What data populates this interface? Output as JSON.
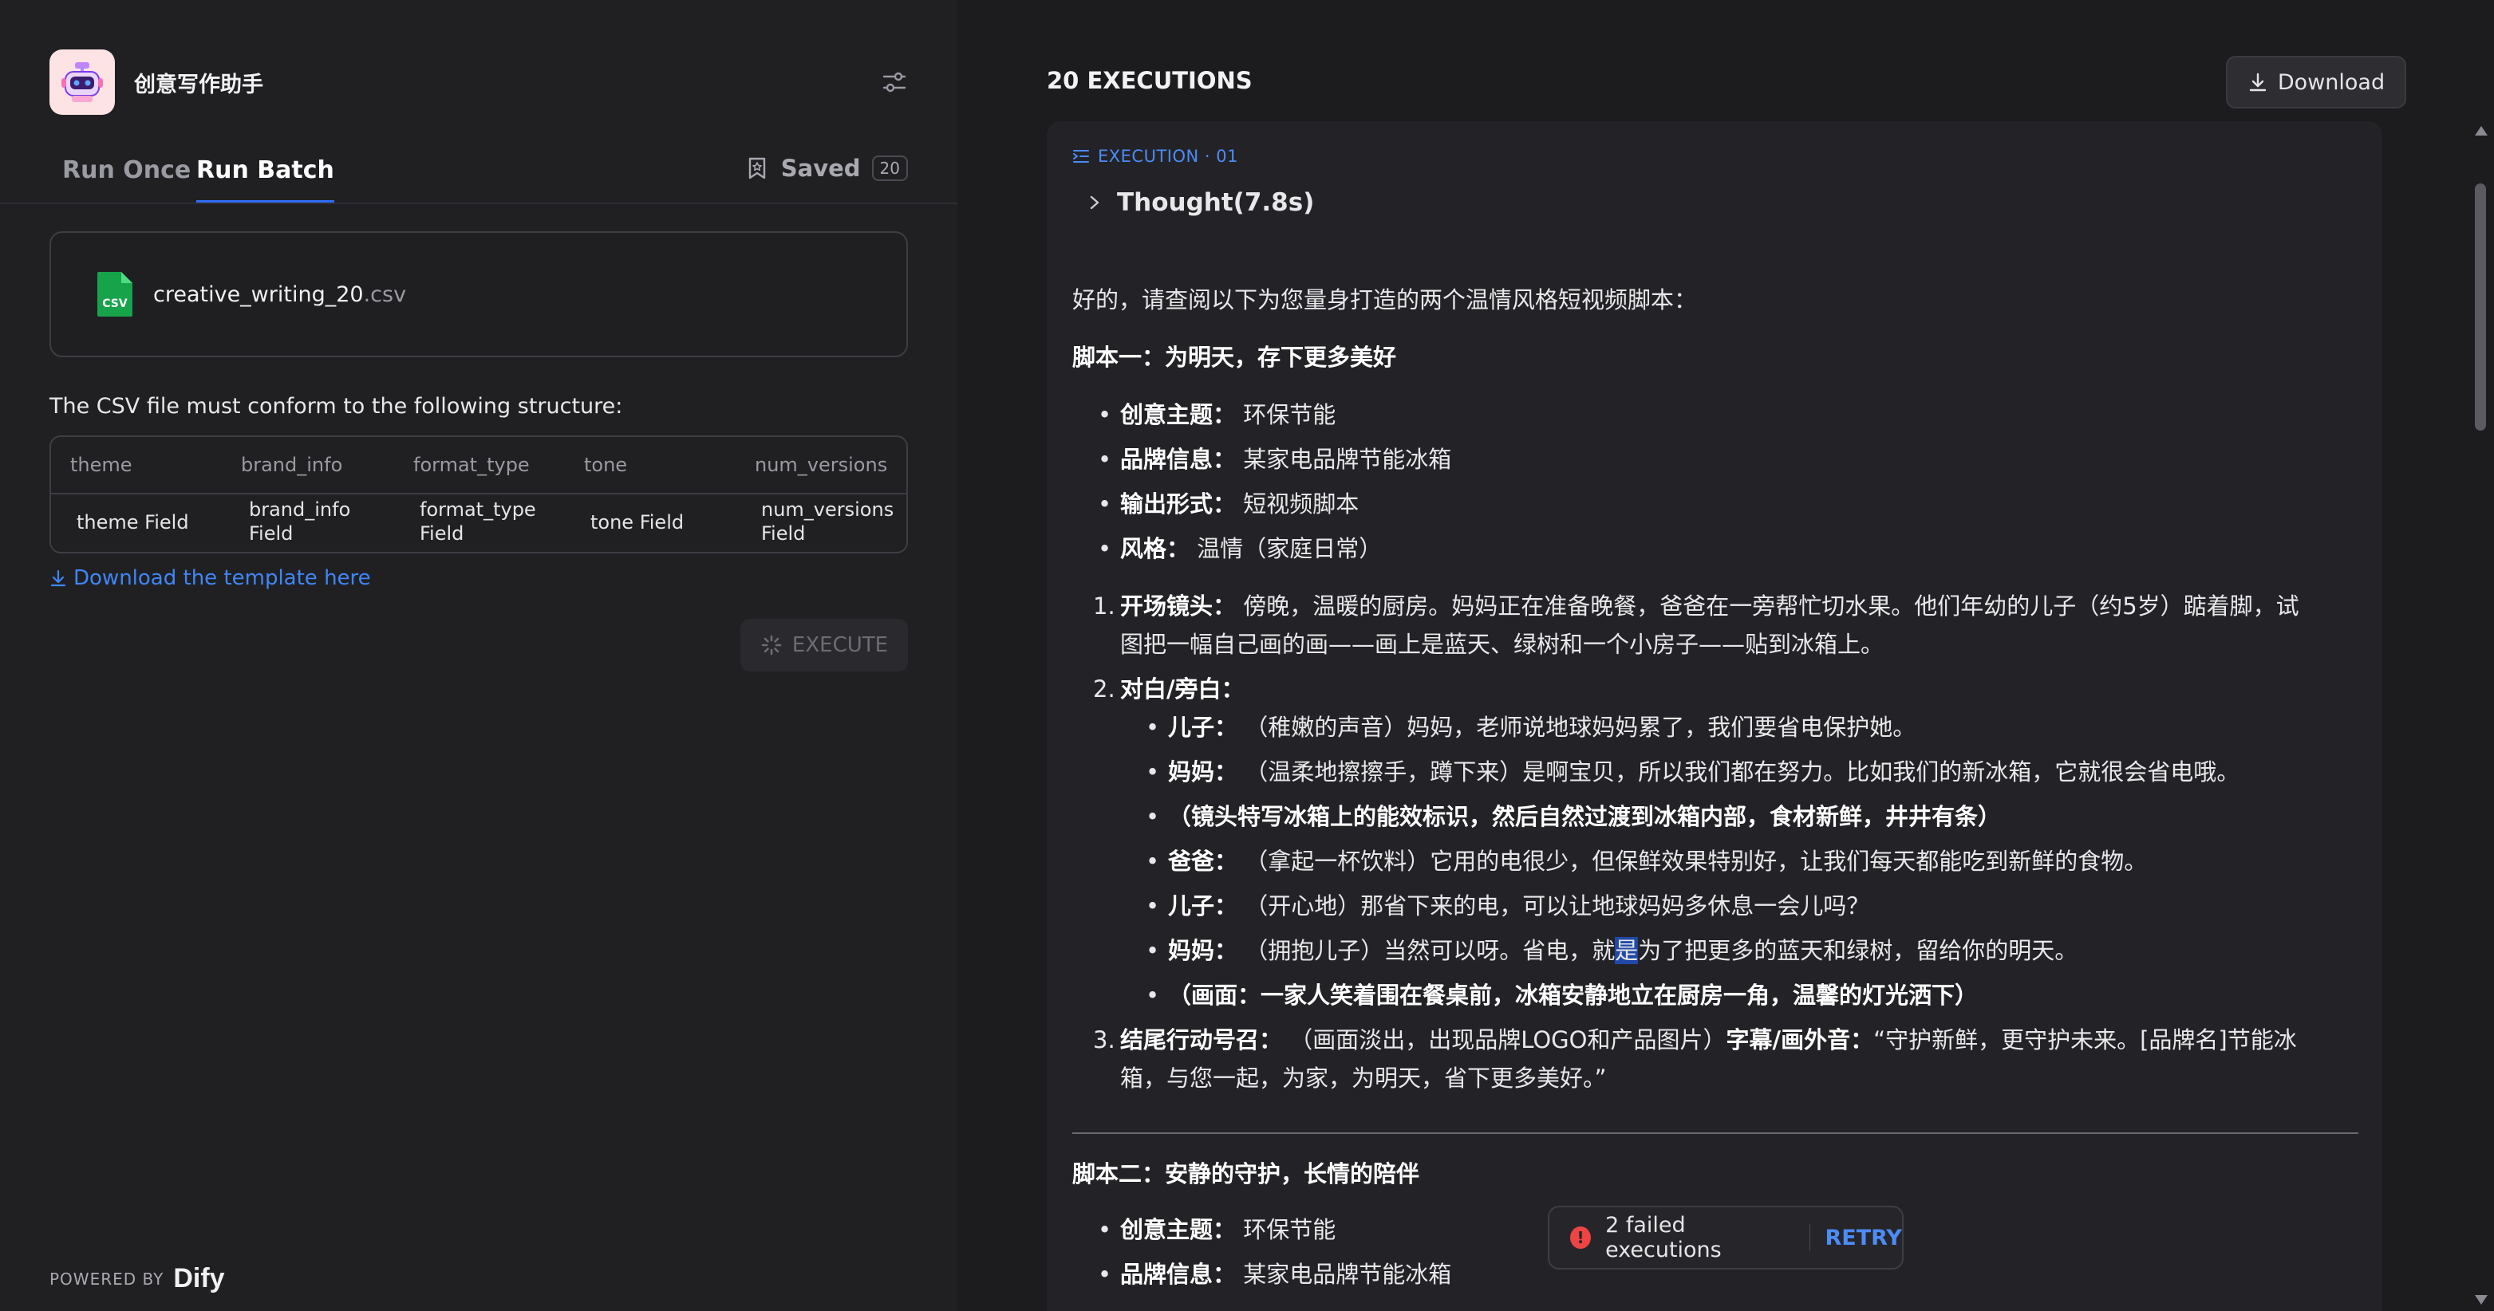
{
  "app": {
    "title": "创意写作助手"
  },
  "tabs": {
    "run_once": "Run Once",
    "run_batch": "Run Batch",
    "saved_label": "Saved",
    "saved_count": "20"
  },
  "file": {
    "name": "creative_writing_20",
    "ext": ".csv",
    "icon_label": "CSV"
  },
  "structure": {
    "text": "The CSV file must conform to the following structure:",
    "headers": [
      "theme",
      "brand_info",
      "format_type",
      "tone",
      "num_versions"
    ],
    "values": [
      "theme Field",
      "brand_info Field",
      "format_type Field",
      "tone Field",
      "num_versions Field"
    ]
  },
  "download_template": "Download the template here",
  "execute_label": "EXECUTE",
  "powered": {
    "label": "POWERED BY",
    "brand": "Dify"
  },
  "results": {
    "title": "20 EXECUTIONS",
    "download_label": "Download",
    "execution_label": "EXECUTION · 01",
    "thought_label": "Thought(7.8s)",
    "intro": "好的，请查阅以下为您量身打造的两个温情风格短视频脚本：",
    "script1_title": "脚本一：为明天，存下更多美好",
    "meta": [
      {
        "k": "创意主题：",
        "v": "环保节能"
      },
      {
        "k": "品牌信息：",
        "v": "某家电品牌节能冰箱"
      },
      {
        "k": "输出形式：",
        "v": "短视频脚本"
      },
      {
        "k": "风格：",
        "v": "温情（家庭日常）"
      }
    ],
    "step1": {
      "num": "1.",
      "k": "开场镜头：",
      "v1": "傍晚，温暖的厨房。妈妈正在准备晚餐，爸爸在一旁帮忙切水果。他们年幼的儿子（约5岁）踮着脚，试",
      "v2": "图把一幅自己画的画——画上是蓝天、绿树和一个小房子——贴到冰箱上。"
    },
    "step2": {
      "num": "2.",
      "k": "对白/旁白："
    },
    "dialog": [
      {
        "k": "儿子：",
        "v": "（稚嫩的声音）妈妈，老师说地球妈妈累了，我们要省电保护她。"
      },
      {
        "k": "妈妈：",
        "v": "（温柔地擦擦手，蹲下来）是啊宝贝，所以我们都在努力。比如我们的新冰箱，它就很会省电哦。"
      },
      {
        "k": "（镜头特写冰箱上的能效标识，然后自然过渡到冰箱内部，食材新鲜，井井有条）",
        "v": ""
      },
      {
        "k": "爸爸：",
        "v": "（拿起一杯饮料）它用的电很少，但保鲜效果特别好，让我们每天都能吃到新鲜的食物。"
      },
      {
        "k": "儿子：",
        "v": "（开心地）那省下来的电，可以让地球妈妈多休息一会儿吗？"
      },
      {
        "k": "妈妈：",
        "v_pre": "（拥抱儿子）当然可以呀。省电，就",
        "v_sel": "是",
        "v_post": "为了把更多的蓝天和绿树，留给你的明天。"
      },
      {
        "k": "（画面：一家人笑着围在餐桌前，冰箱安静地立在厨房一角，温馨的灯光洒下）",
        "v": ""
      }
    ],
    "step3": {
      "num": "3.",
      "k": "结尾行动号召：",
      "v1a": "（画面淡出，出现品牌LOGO和产品图片）",
      "k2": "字幕/画外音：",
      "v1b": "“守护新鲜，更守护未来。[品牌名]节能冰",
      "v2": "箱，与您一起，为家，为明天，省下更多美好。”"
    },
    "script2_title": "脚本二：安静的守护，长情的陪伴",
    "meta2": [
      {
        "k": "创意主题：",
        "v": "环保节能"
      },
      {
        "k": "品牌信息：",
        "v": "某家电品牌节能冰箱"
      }
    ]
  },
  "toast": {
    "text": "2 failed executions",
    "retry": "RETRY",
    "icon": "!"
  },
  "colors": {
    "accent": "#2f6bf5",
    "link": "#3f86f7",
    "error": "#ef4444",
    "csv_green": "#16a34a"
  }
}
